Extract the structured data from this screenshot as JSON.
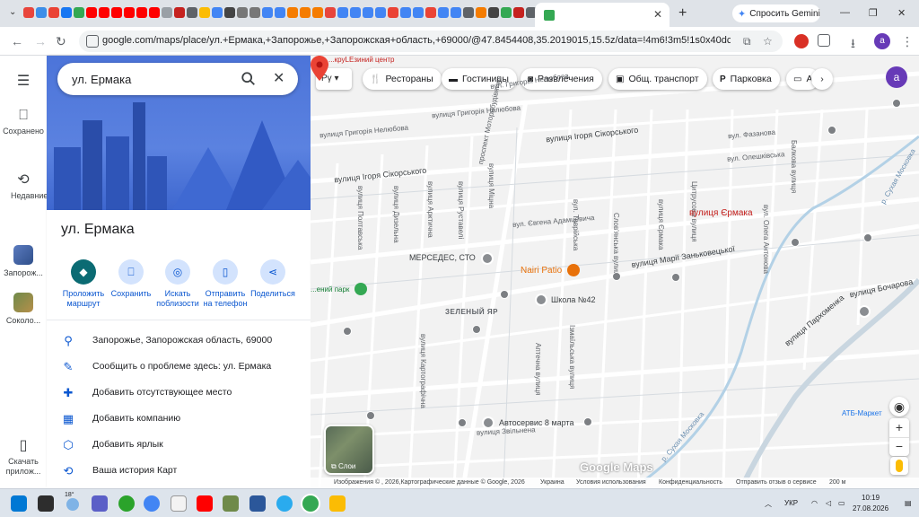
{
  "browser": {
    "gemini_label": "Спросить Gemini",
    "url": "google.com/maps/place/ул.+Ермака,+Запорожье,+Запорожская+область,+69000/@47.8454408,35.2019015,15.5z/data=!4m6!3m5!1s0x40dc5d9b110973...",
    "profile_initial": "a"
  },
  "rail": {
    "saved": "Сохранено",
    "recent": "Недавние",
    "recent_place_1": "Запорож...",
    "recent_place_2": "Соколо...",
    "app": "Скачать прилож..."
  },
  "panel": {
    "search_value": "ул. Ермака",
    "place_title": "ул. Ермака",
    "actions": [
      {
        "label": "Проложить маршрут"
      },
      {
        "label": "Сохранить"
      },
      {
        "label": "Искать поблизости"
      },
      {
        "label": "Отправить на телефон"
      },
      {
        "label": "Поделиться"
      }
    ],
    "info": [
      {
        "text": "Запорожье, Запорожская область, 69000",
        "icon": "location-icon"
      },
      {
        "text": "Сообщить о проблеме здесь: ул. Ермака",
        "icon": "edit-icon"
      },
      {
        "text": "Добавить отсутствующее место",
        "icon": "add-place-icon"
      },
      {
        "text": "Добавить компанию",
        "icon": "business-icon"
      },
      {
        "text": "Добавить ярлык",
        "icon": "label-icon"
      },
      {
        "text": "Ваша история Карт",
        "icon": "history-icon"
      }
    ]
  },
  "map": {
    "chips": [
      "Рестораны",
      "Гостиницы",
      "Развлечения",
      "Общ. транспорт",
      "Парковка",
      "А"
    ],
    "pin_label": "вулиця Єрмака",
    "top_label": "...круLEзиний центр",
    "streets": {
      "igor_sikorsky_1": "вулиця Ігоря Сікорського",
      "igor_sikorsky_2": "вулиця Ігоря Сікорського",
      "grigoriya_1": "вулиця Григорія Нелюбова",
      "grigoriya_2": "вул. Григорія Нелюбова",
      "fazanova": "вул. Фазанова",
      "oleshkivska": "вул. Олешківська",
      "adamtsevycha": "вул. Євгена Адамцевича",
      "zankovetskoi": "вулиця Марії Заньковецької",
      "bocharova": "вулиця Бочарова",
      "parkhomenka": "вулиця Пархоменка",
      "motorobudivnykiv": "проспект Моторобудівників",
      "tavriiska": "вул. Таврійська",
      "slovianska": "Слов'янська вулиця",
      "ermaka": "вулиця Єрмака",
      "tsytrusova": "Цитрусова вулиця",
      "oleha_antonova": "вул. Олега Антонова",
      "poltavska": "вулиця Полтавська",
      "dyzelna": "вулиця Дизельна",
      "arktychna": "вулиця Арктична",
      "rustaveli": "вулиця Руставелі",
      "mitsna": "вулиця Міцна",
      "sukhyi_moskovka": "р. Сухая Московка",
      "zvilnena": "вулиця Звільнена",
      "aptechna": "Аптечна вулиця",
      "izmailivska": "Ізмаїльська вулиця",
      "kartografichna": "вулиця Картографічна",
      "balkova": "Балкова вулиця"
    },
    "pois": {
      "mercedes": "МЕРСЕДЕС, СТО",
      "nairi": "Nairi Patio",
      "school": "Школа №42",
      "district": "ЗЕЛЕНЫЙ ЯР",
      "autoservice": "Автосервис 8 марта",
      "park": "...ений парк",
      "atb": "АТБ-Маркет"
    },
    "layers_label": "Слои",
    "google_logo": "Google Maps",
    "footer": {
      "imagery": "Изображения © , 2026,Картографические данные © Google, 2026",
      "country": "Украина",
      "terms": "Условия использования",
      "privacy": "Конфиденциальность",
      "feedback": "Отправить отзыв о сервисе",
      "scale": "200 м"
    }
  },
  "taskbar": {
    "weather": "18°",
    "lang": "УКР",
    "time": "10:19",
    "date": "27.08.2026"
  }
}
